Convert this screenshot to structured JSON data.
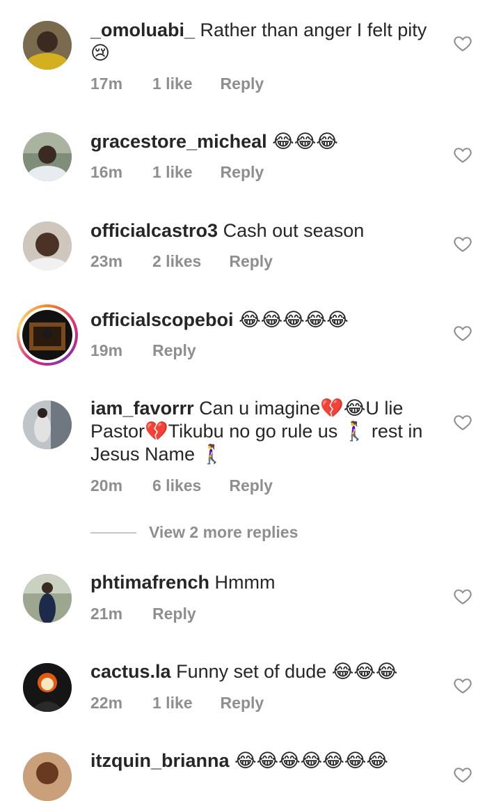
{
  "comments": [
    {
      "username": "_omoluabi_",
      "text": "Rather than anger I felt pity 😢",
      "time": "17m",
      "likes": "1 like",
      "reply": "Reply",
      "avatar_color": "#c8a227"
    },
    {
      "username": "gracestore_micheal",
      "text": "😂😂😂",
      "time": "16m",
      "likes": "1 like",
      "reply": "Reply",
      "avatar_color": "#5a6b7a"
    },
    {
      "username": "officialcastro3",
      "text": "Cash out season",
      "time": "23m",
      "likes": "2 likes",
      "reply": "Reply",
      "avatar_color": "#6b5a4a"
    },
    {
      "username": "officialscopeboi",
      "text": "😂😂😂😂😂",
      "time": "19m",
      "likes": "",
      "reply": "Reply",
      "avatar_color": "#1a1a1a"
    },
    {
      "username": "iam_favorrr",
      "text": "Can u imagine💔😂U lie Pastor💔Tikubu no go rule us 🚶‍♀️ rest in Jesus Name 🚶‍♀️",
      "time": "20m",
      "likes": "6 likes",
      "reply": "Reply",
      "avatar_color": "#9aa3ad"
    },
    {
      "username": "phtimafrench",
      "text": "Hmmm",
      "time": "21m",
      "likes": "",
      "reply": "Reply",
      "avatar_color": "#7d8a6c"
    },
    {
      "username": "cactus.la",
      "text": "Funny set of dude 😂😂😂",
      "time": "22m",
      "likes": "1 like",
      "reply": "Reply",
      "avatar_color": "#2a2a2a"
    },
    {
      "username": "itzquin_brianna",
      "text": "😂😂😂😂😂😂😂",
      "time": "",
      "likes": "",
      "reply": "",
      "avatar_color": "#b07a4a"
    }
  ],
  "view_more": "View 2 more replies",
  "colors": {
    "text": "#262626",
    "meta": "#8e8e8e",
    "heart": "#8e8e8e"
  }
}
